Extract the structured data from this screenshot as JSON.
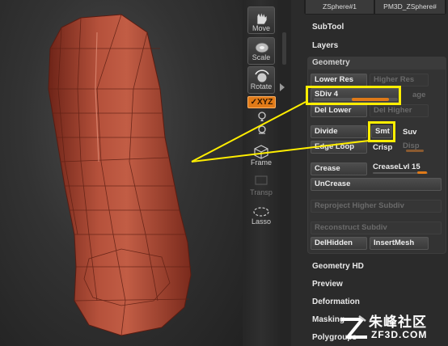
{
  "toolbar": {
    "move": "Move",
    "scale": "Scale",
    "rotate": "Rotate",
    "xyz": "✓XYZ",
    "frame": "Frame",
    "transp": "Transp",
    "lasso": "Lasso"
  },
  "subtool_buttons": [
    "ZSphere#1",
    "PM3D_ZSphere#"
  ],
  "panel": {
    "subtool": "SubTool",
    "layers": "Layers",
    "geometry": {
      "title": "Geometry",
      "lower_res": "Lower Res",
      "higher_res": "Higher Res",
      "sdiv": "SDiv 4",
      "sdiv_level": 4,
      "sdiv_hidden_label": "age",
      "del_lower": "Del Lower",
      "del_higher": "Del Higher",
      "divide": "Divide",
      "smt": "Smt",
      "suv": "Suv",
      "edge_loop": "Edge Loop",
      "crisp": "Crisp",
      "disp": "Disp",
      "crease": "Crease",
      "crease_lvl": "CreaseLvl 15",
      "uncrease": "UnCrease",
      "reproject": "Reproject Higher Subdiv",
      "reconstruct": "Reconstruct Subdiv",
      "delhidden": "DelHidden",
      "insertmesh": "InsertMesh"
    },
    "geometry_hd": "Geometry HD",
    "preview": "Preview",
    "deformation": "Deformation",
    "masking": "Masking",
    "polygroups": "Polygroups"
  },
  "watermark": {
    "cn": "朱峰社区",
    "en": "ZF3D.COM"
  },
  "colors": {
    "accent": "#e07a18",
    "highlight": "#ffee00",
    "model": "#9e3e2c"
  }
}
